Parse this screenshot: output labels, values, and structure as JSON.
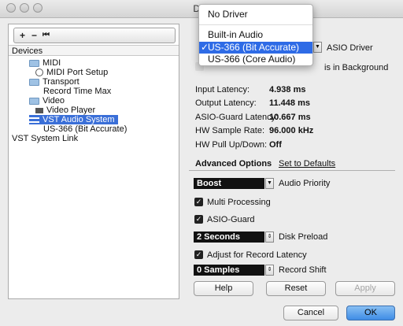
{
  "window": {
    "title": "Dev"
  },
  "toolbar": {
    "add": "+",
    "remove": "−",
    "reset": "⏮"
  },
  "devices": {
    "header": "Devices",
    "items": [
      {
        "label": "MIDI"
      },
      {
        "label": "MIDI Port Setup"
      },
      {
        "label": "Transport"
      },
      {
        "label": "Record Time Max"
      },
      {
        "label": "Video"
      },
      {
        "label": "Video Player"
      },
      {
        "label": "VST Audio System"
      },
      {
        "label": "US-366 (Bit Accurate)"
      },
      {
        "label": "VST System Link"
      }
    ]
  },
  "driver_menu": {
    "items": [
      "No Driver",
      "Built-in Audio",
      "US-366 (Bit Accurate)",
      "US-366 (Core Audio)"
    ],
    "selected_index": 2,
    "checkmark": "✓"
  },
  "asio": {
    "driver_label": "ASIO Driver",
    "background_partial": "is in Background"
  },
  "latency": {
    "input_label": "Input Latency:",
    "input_value": "4.938 ms",
    "output_label": "Output Latency:",
    "output_value": "11.448 ms",
    "guard_label": "ASIO-Guard Latency:",
    "guard_value": "10.667 ms",
    "rate_label": "HW Sample Rate:",
    "rate_value": "96.000 kHz",
    "pull_label": "HW Pull Up/Down:",
    "pull_value": "Off"
  },
  "advanced": {
    "tab": "Advanced Options",
    "defaults": "Set to Defaults",
    "priority_value": "Boost",
    "priority_label": "Audio Priority",
    "multiprocessing": "Multi Processing",
    "asio_guard": "ASIO-Guard",
    "preload_value": "2 Seconds",
    "preload_label": "Disk Preload",
    "adjust_latency": "Adjust for Record Latency",
    "shift_value": "0 Samples",
    "shift_label": "Record Shift"
  },
  "buttons": {
    "help": "Help",
    "reset": "Reset",
    "apply": "Apply",
    "cancel": "Cancel",
    "ok": "OK"
  },
  "colors": {
    "selection": "#2e6be6",
    "ok_button": "#3f8ce6"
  }
}
